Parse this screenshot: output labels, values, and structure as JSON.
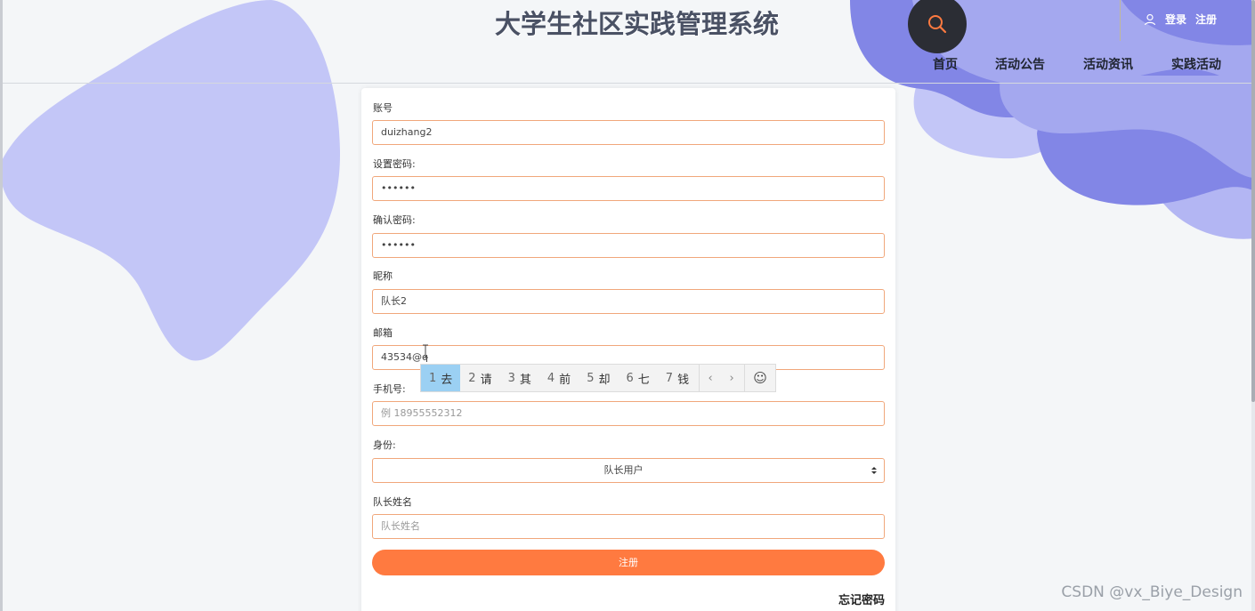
{
  "header": {
    "site_title": "大学生社区实践管理系统",
    "login_label": "登录",
    "register_label": "注册"
  },
  "nav": {
    "items": [
      {
        "label": "首页"
      },
      {
        "label": "活动公告"
      },
      {
        "label": "活动资讯"
      },
      {
        "label": "实践活动"
      }
    ]
  },
  "form": {
    "account": {
      "label": "账号",
      "value": "duizhang2"
    },
    "password": {
      "label": "设置密码:",
      "value": "••••••"
    },
    "confirm_password": {
      "label": "确认密码:",
      "value": "••••••"
    },
    "nickname": {
      "label": "昵称",
      "value": "队长2"
    },
    "email": {
      "label": "邮箱",
      "value": "43534@q"
    },
    "phone": {
      "label": "手机号:",
      "placeholder": "例  18955552312"
    },
    "identity": {
      "label": "身份:",
      "selected": "队长用户"
    },
    "captain_name": {
      "label": "队长姓名",
      "placeholder": "队长姓名"
    },
    "submit_label": "注册",
    "forgot_label": "忘记密码"
  },
  "ime": {
    "candidates": [
      {
        "num": "1",
        "text": "去"
      },
      {
        "num": "2",
        "text": "请"
      },
      {
        "num": "3",
        "text": "其"
      },
      {
        "num": "4",
        "text": "前"
      },
      {
        "num": "5",
        "text": "却"
      },
      {
        "num": "6",
        "text": "七"
      },
      {
        "num": "7",
        "text": "钱"
      }
    ],
    "prev_glyph": "‹",
    "next_glyph": "›",
    "emoji_glyph": "☺"
  },
  "watermark": "CSDN @vx_Biye_Design",
  "colors": {
    "accent": "#ff7a40",
    "input_border": "#f0a77b",
    "blob_light": "#c3c6f7",
    "blob_mid": "#a4a8ef",
    "blob_dark": "#8286e6",
    "title": "#4a5164"
  }
}
